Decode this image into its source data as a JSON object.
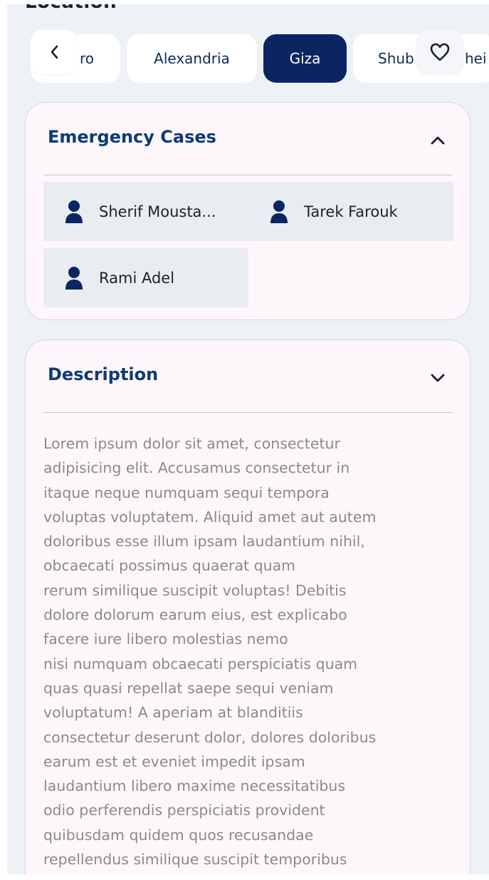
{
  "location": {
    "heading": "Location",
    "chips": [
      {
        "label": "ro"
      },
      {
        "label": "Alexandria"
      },
      {
        "label": "Giza",
        "active": true
      },
      {
        "label": "Shub",
        "label_end": "hei"
      }
    ]
  },
  "icons": {
    "back": "chevron-left-icon",
    "favorite": "heart-outline-icon",
    "collapse": "chevron-up-icon",
    "expand": "chevron-down-icon",
    "person": "person-icon"
  },
  "colors": {
    "accent": "#0b2563",
    "title": "#0e3b73",
    "background": "#eef2f7",
    "card": "#fdf7fc",
    "item_background": "#e9edf1",
    "body_text": "#8a8a8a"
  },
  "emergency": {
    "title": "Emergency Cases",
    "cases": [
      {
        "name": "Sherif Mousta..."
      },
      {
        "name": "Tarek Farouk"
      },
      {
        "name": "Rami Adel"
      }
    ]
  },
  "description": {
    "title": "Description",
    "text": "Lorem ipsum dolor sit amet, consectetur\nadipisicing elit. Accusamus consectetur in\nitaque neque numquam sequi tempora\nvoluptas voluptatem. Aliquid amet aut autem\ndoloribus esse illum ipsam laudantium nihil,\nobcaecati possimus quaerat quam\nrerum similique suscipit voluptas! Debitis\ndolore dolorum earum eius, est explicabo\nfacere iure libero molestias nemo\nnisi numquam obcaecati perspiciatis quam\nquas quasi repellat saepe sequi veniam\nvoluptatum! A aperiam at blanditiis\nconsectetur deserunt dolor, dolores doloribus\nearum est et eveniet impedit ipsam\nlaudantium libero maxime necessitatibus\nodio perferendis perspiciatis provident\nquibusdam quidem quos recusandae\nrepellendus similique suscipit temporibus"
  }
}
